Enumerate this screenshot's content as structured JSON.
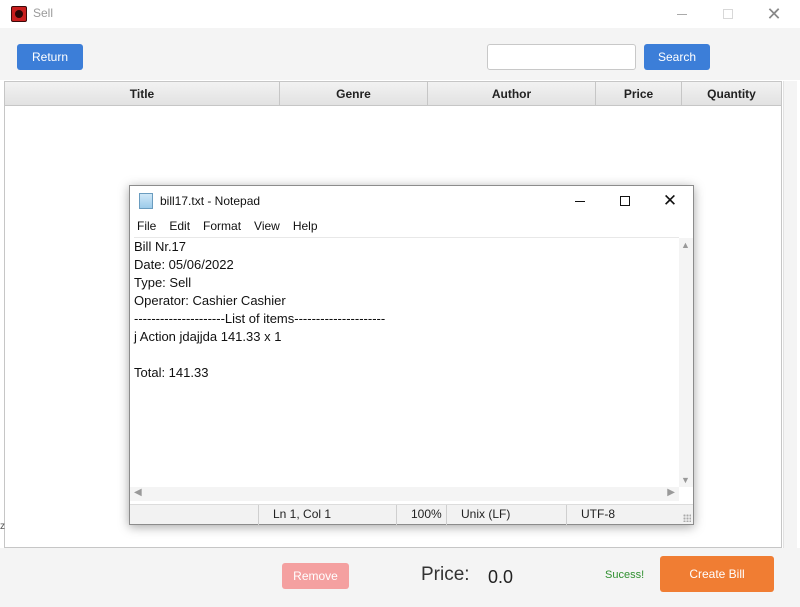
{
  "window": {
    "title": "Sell"
  },
  "toolbar": {
    "return_label": "Return",
    "search_placeholder": "",
    "search_value": "",
    "search_label": "Search"
  },
  "table": {
    "columns": [
      "Title",
      "Genre",
      "Author",
      "Price",
      "Quantity"
    ]
  },
  "bottom": {
    "remove_label": "Remove",
    "price_label": "Price:",
    "price_value": "0.0",
    "status": "Sucess!",
    "create_bill_label": "Create Bill"
  },
  "colors": {
    "primary_button": "#3c7ed8",
    "remove_button": "#f4a0a0",
    "create_button": "#f07d33",
    "status_text": "#2f8f2f"
  },
  "notepad": {
    "title": "bill17.txt - Notepad",
    "menu": [
      "File",
      "Edit",
      "Format",
      "View",
      "Help"
    ],
    "lines": [
      "Bill Nr.17",
      "Date: 05/06/2022",
      "Type: Sell",
      "Operator: Cashier Cashier",
      "---------------------List of items---------------------",
      "j Action jdajjda 141.33 x 1",
      "",
      "Total: 141.33"
    ],
    "status": {
      "position": "Ln 1, Col 1",
      "zoom": "100%",
      "line_ending": "Unix (LF)",
      "encoding": "UTF-8"
    }
  }
}
